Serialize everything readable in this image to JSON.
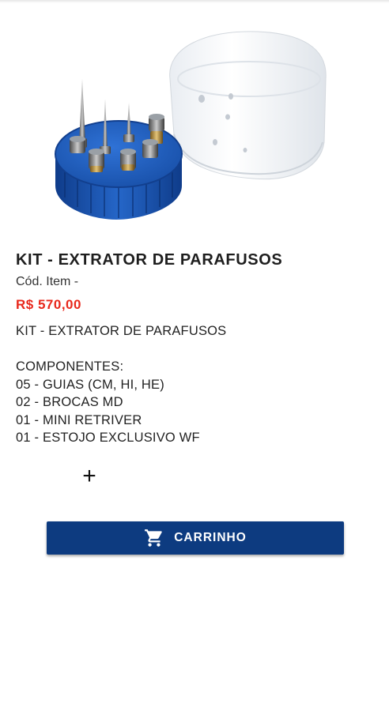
{
  "product": {
    "image_alt": "kit-extrator-image",
    "title": "KIT - EXTRATOR DE PARAFUSOS",
    "code_label": "Cód. Item -",
    "price": "R$ 570,00",
    "description_lines": [
      "KIT - EXTRATOR DE PARAFUSOS",
      "",
      "COMPONENTES:",
      "05 - GUIAS (CM, HI, HE)",
      "02 - BROCAS MD",
      "01 - MINI RETRIVER",
      "01 - ESTOJO EXCLUSIVO WF"
    ]
  },
  "actions": {
    "add_icon": "plus-icon",
    "cart_icon": "cart-icon",
    "cart_label": "CARRINHO"
  },
  "colors": {
    "price": "#e8281c",
    "button": "#0d3b80",
    "case_blue": "#1f5bb5"
  }
}
